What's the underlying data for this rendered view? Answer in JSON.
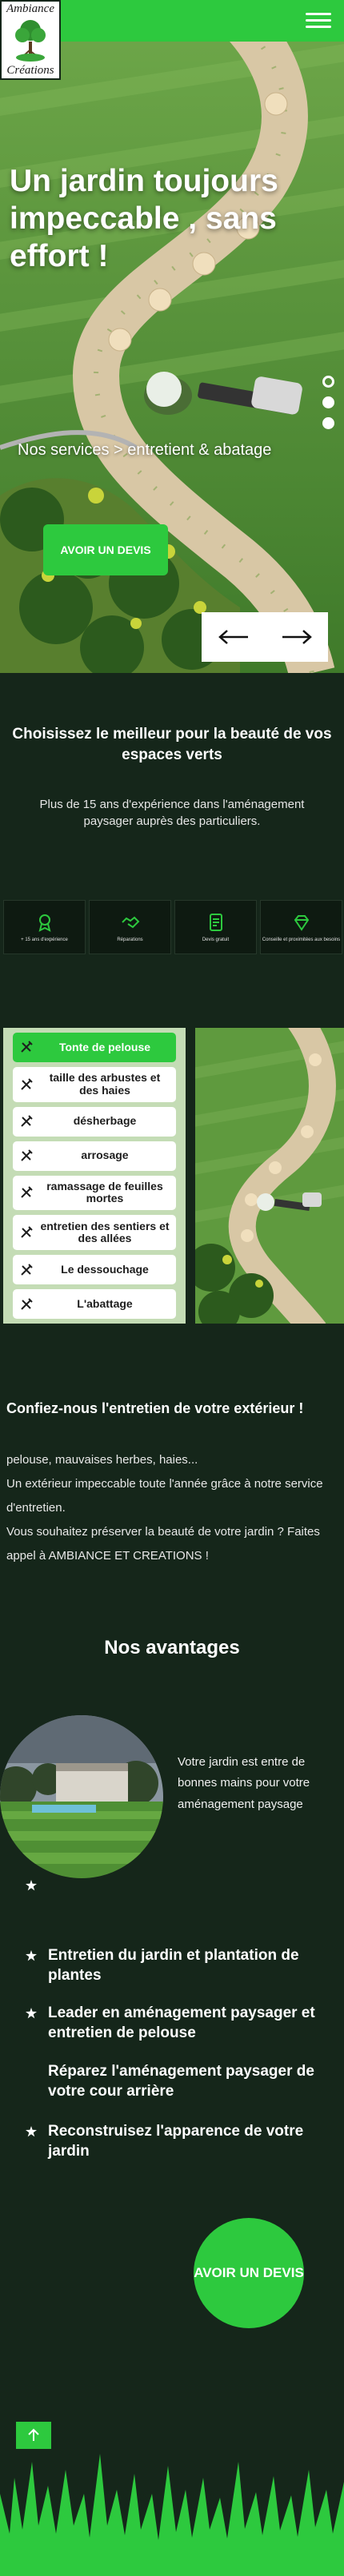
{
  "brand": {
    "logo_top": "Ambiance",
    "logo_bottom": "Créations"
  },
  "colors": {
    "accent": "#2dc93e",
    "background": "#15261a",
    "services_panel": "#c4dcb5"
  },
  "header": {
    "menu_icon": "hamburger-menu-icon"
  },
  "hero": {
    "title": "Un jardin toujours impeccable , sans effort !",
    "subtitle": "Nos services > entretient & abatage",
    "cta": "AVOIR UN DEVIS",
    "slides": 3,
    "active_slide": 1,
    "prev_icon": "arrow-left-icon",
    "next_icon": "arrow-right-icon"
  },
  "intro": {
    "title": "Choisissez le meilleur pour la beauté de vos espaces verts",
    "text": "Plus de 15 ans d'expérience dans l'aménagement paysager auprès des particuliers."
  },
  "stats": [
    {
      "icon": "award-icon",
      "label": "+ 15 ans d'expérience"
    },
    {
      "icon": "handshake-icon",
      "label": "Réparations"
    },
    {
      "icon": "quote-document-icon",
      "label": "Devis gratuit"
    },
    {
      "icon": "diamond-icon",
      "label": "Conseille et proximitées aux besoins"
    }
  ],
  "services": [
    {
      "label": "Tonte de pelouse",
      "active": true
    },
    {
      "label": "taille des arbustes et des haies",
      "active": false
    },
    {
      "label": "désherbage",
      "active": false
    },
    {
      "label": "arrosage",
      "active": false
    },
    {
      "label": "ramassage de feuilles mortes",
      "active": false
    },
    {
      "label": "entretien des sentiers et des allées",
      "active": false
    },
    {
      "label": "Le dessouchage",
      "active": false
    },
    {
      "label": "L'abattage",
      "active": false
    }
  ],
  "about": {
    "heading": "Confiez-nous l'entretien de votre extérieur !",
    "line1": "pelouse, mauvaises herbes, haies...",
    "line2": "Un extérieur impeccable toute l'année grâce à notre service d'entretien.",
    "line3": "Vous souhaitez préserver la beauté de votre jardin ? Faites appel à AMBIANCE ET CREATIONS !"
  },
  "advantages": {
    "title": "Nos avantages",
    "caption": "Votre jardin est entre de bonnes mains pour votre aménagement paysage",
    "items": [
      "Entretien du jardin et plantation de plantes",
      "Leader en aménagement paysager et entretien de pelouse",
      "Réparez l'aménagement paysager de votre cour arrière",
      "Reconstruisez l'apparence de votre jardin"
    ],
    "cta": "AVOIR UN DEVIS"
  },
  "footer": {
    "scroll_top_icon": "arrow-up-icon"
  }
}
